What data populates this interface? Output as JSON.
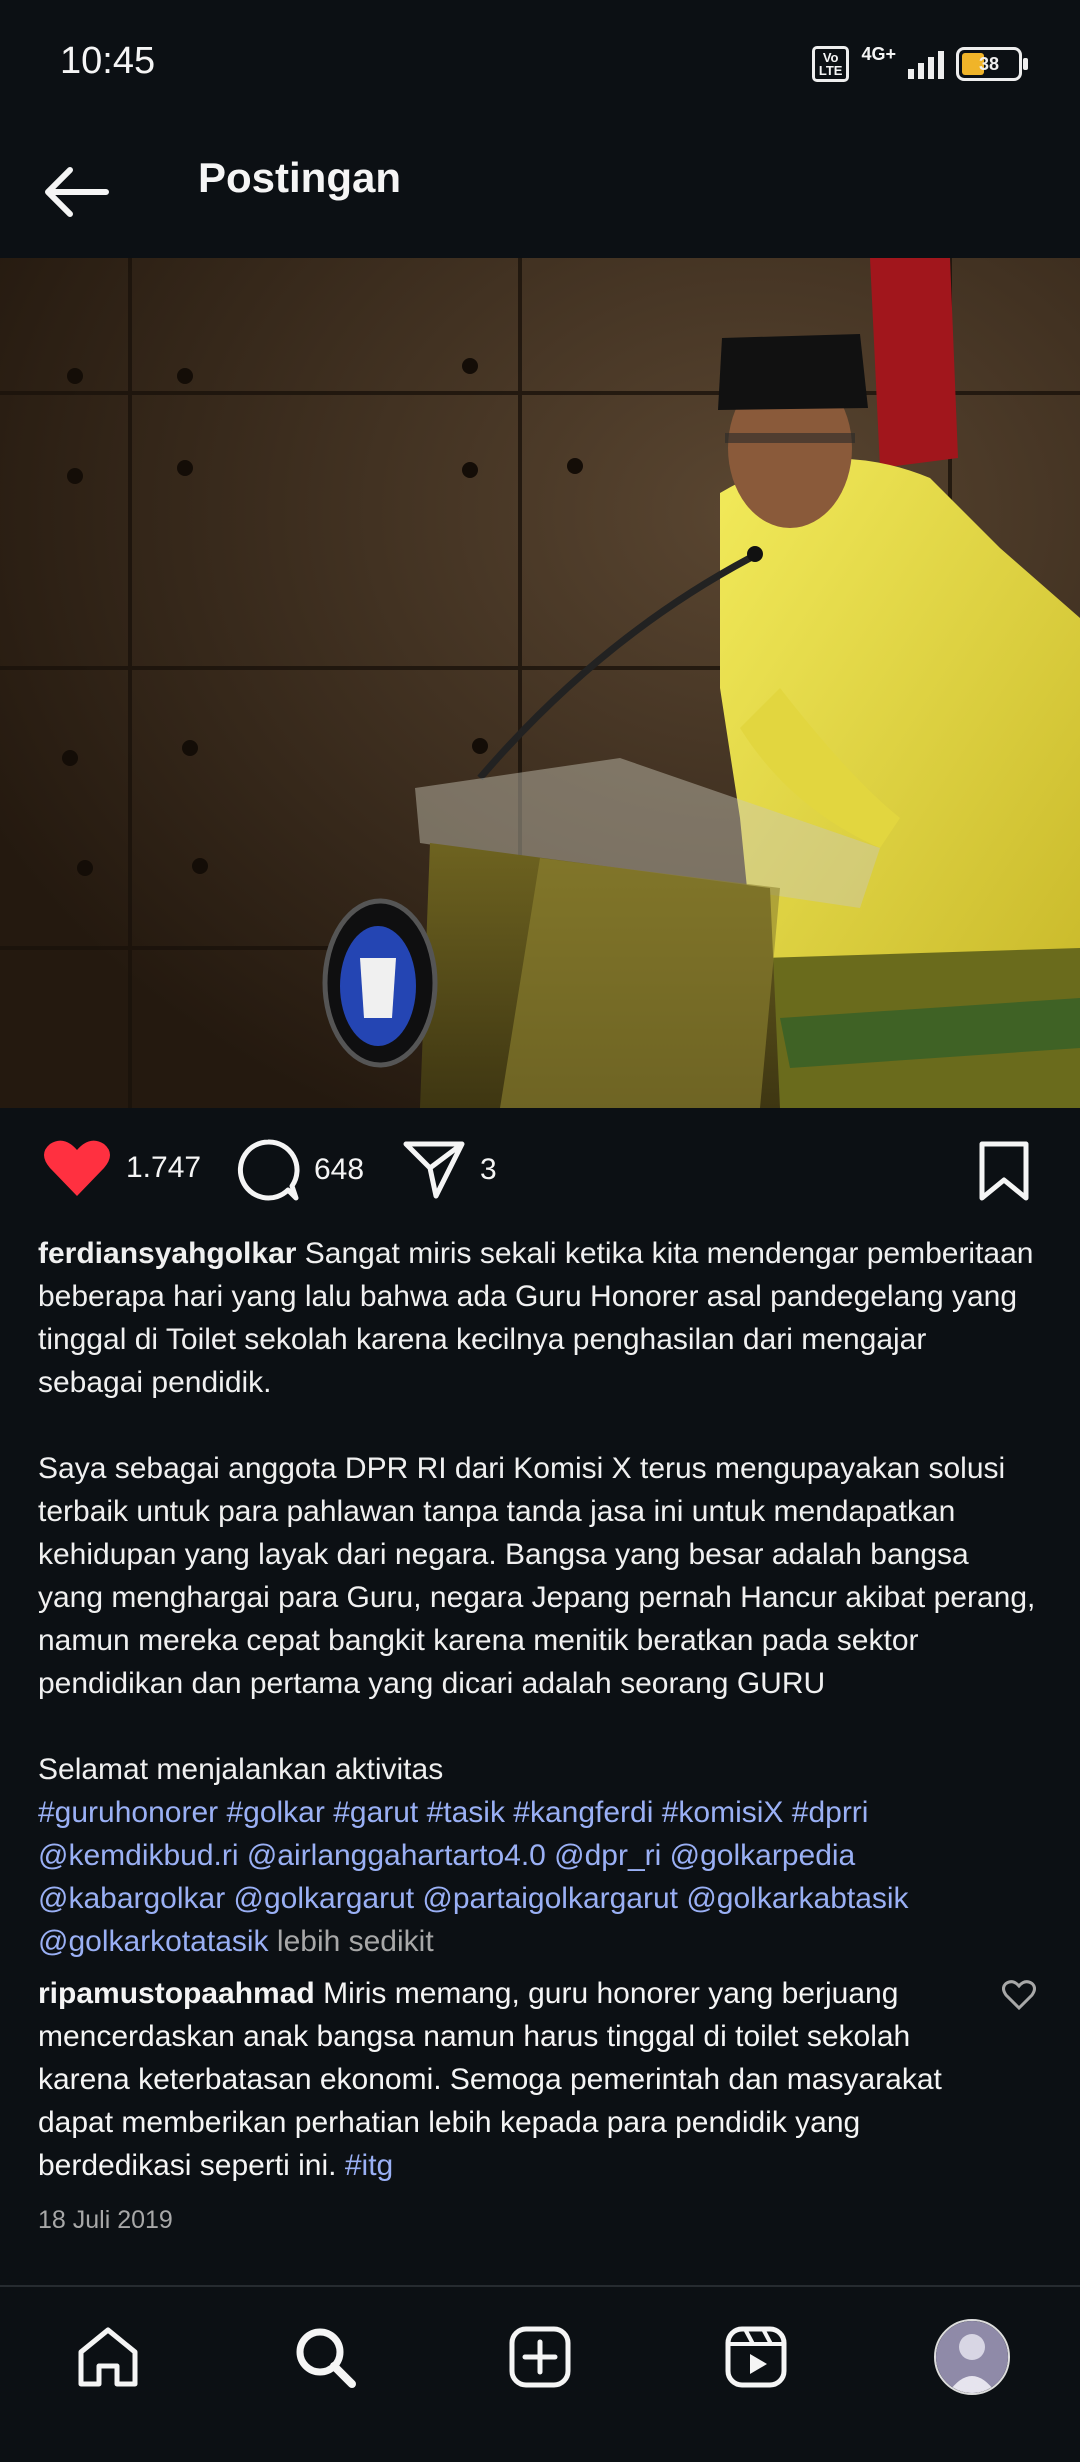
{
  "status_bar": {
    "time": "10:45",
    "volte_line1": "Vo",
    "volte_line2": "LTE",
    "network": "4G+",
    "battery": "38"
  },
  "header": {
    "title": "Postingan",
    "back_icon": "arrow-left-icon"
  },
  "post": {
    "image_icon": "post-photo",
    "likes": "1.747",
    "comments": "648",
    "shares": "3",
    "colors": {
      "like": "#ff3040",
      "hashtag": "#9ab0f5",
      "background": "#0c1014"
    }
  },
  "caption": {
    "username": "ferdiansyahgolkar",
    "paragraph1": "Sangat miris sekali ketika kita mendengar pemberitaan beberapa hari yang lalu bahwa ada Guru Honorer asal pandegelang yang tinggal di Toilet sekolah karena kecilnya penghasilan dari mengajar sebagai pendidik.",
    "paragraph2": "Saya sebagai anggota DPR RI dari Komisi X terus mengupayakan solusi terbaik untuk para pahlawan tanpa tanda jasa ini untuk mendapatkan kehidupan yang layak dari negara. Bangsa yang besar adalah bangsa yang menghargai para Guru, negara Jepang pernah Hancur akibat perang, namun mereka cepat bangkit karena menitik beratkan pada sektor pendidikan dan pertama yang dicari adalah seorang GURU",
    "paragraph3": "Selamat menjalankan aktivitas",
    "tags": "#guruhonorer #golkar #garut #tasik #kangferdi #komisiX #dprri @kemdikbud.ri @airlanggahartarto4.0 @dpr_ri @golkarpedia @kabargolkar @golkargarut @partaigolkargarut @golkarkabtasik @golkarkotatasik",
    "less_label": "lebih sedikit"
  },
  "comment": {
    "username": "ripamustopaahmad",
    "text": "Miris memang, guru honorer yang berjuang mencerdaskan anak bangsa namun harus tinggal di toilet sekolah karena keterbatasan ekonomi. Semoga pemerintah dan masyarakat dapat memberikan perhatian lebih kepada para pendidik yang berdedikasi seperti ini.",
    "tag": "#itg"
  },
  "date": "18 Juli 2019",
  "nav": {
    "items": [
      "home-icon",
      "search-icon",
      "create-icon",
      "reels-icon",
      "profile-avatar"
    ]
  }
}
